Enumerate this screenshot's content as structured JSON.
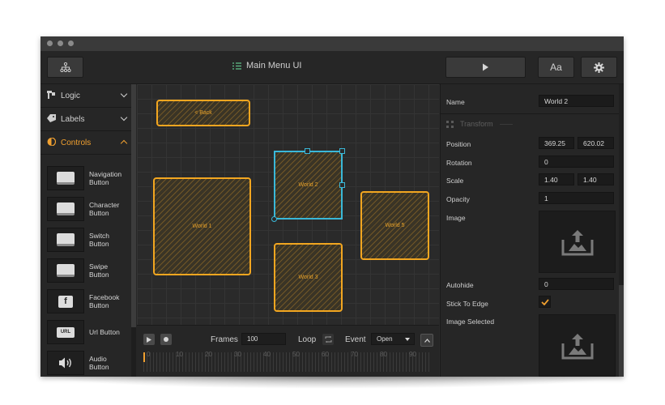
{
  "window": {
    "title": "Main Menu UI",
    "font_button_label": "Aa"
  },
  "sidebar": {
    "sections": [
      {
        "label": "Logic",
        "icon": "logic-icon"
      },
      {
        "label": "Labels",
        "icon": "tag-icon"
      },
      {
        "label": "Controls",
        "icon": "controls-icon",
        "active": true
      }
    ],
    "components": [
      {
        "label": "Navigation Button",
        "icon": "button-icon"
      },
      {
        "label": "Character Button",
        "icon": "button-icon"
      },
      {
        "label": "Switch Button",
        "icon": "button-icon"
      },
      {
        "label": "Swipe Button",
        "icon": "button-icon"
      },
      {
        "label": "Facebook Button",
        "icon": "facebook-icon",
        "glyph": "f"
      },
      {
        "label": "Url Button",
        "icon": "url-icon",
        "glyph": "URL"
      },
      {
        "label": "Audio Button",
        "icon": "speaker-icon"
      }
    ]
  },
  "canvas": {
    "nodes": {
      "back": "< Back",
      "world1": "World 1",
      "world2": "World 2",
      "world3": "World 3",
      "world5": "World 5"
    }
  },
  "timeline": {
    "frames_label": "Frames",
    "frames_value": "100",
    "loop_label": "Loop",
    "event_label": "Event",
    "event_value": "Open",
    "ticks": [
      "0",
      "10",
      "20",
      "30",
      "40",
      "50",
      "60",
      "70",
      "80",
      "90"
    ]
  },
  "properties": {
    "name_label": "Name",
    "name_value": "World 2",
    "transform_label": "Transform",
    "position_label": "Position",
    "position_x": "369.25",
    "position_y": "620.02",
    "rotation_label": "Rotation",
    "rotation_value": "0",
    "scale_label": "Scale",
    "scale_x": "1.40",
    "scale_y": "1.40",
    "opacity_label": "Opacity",
    "opacity_value": "1",
    "image_label": "Image",
    "autohide_label": "Autohide",
    "autohide_value": "0",
    "stick_label": "Stick To Edge",
    "stick_checked": true,
    "image_selected_label": "Image Selected"
  },
  "colors": {
    "accent": "#f0a030",
    "selection": "#3ab8d8",
    "background": "#2b2b2b"
  }
}
